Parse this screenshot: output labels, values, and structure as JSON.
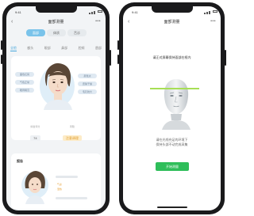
{
  "left_phone": {
    "status_time": "9:41",
    "nav": {
      "back": "‹",
      "title": "面部测量",
      "more": "•••"
    },
    "segments": [
      "面部",
      "体质",
      "舌诊"
    ],
    "feature_tabs": [
      "全脸",
      "额头",
      "眼部",
      "鼻部",
      "脸颊",
      "唇部"
    ],
    "face_chips_left": [
      "面色红润",
      "气色正常",
      "眼周暗沉"
    ],
    "face_chips_right": [
      "唇色淡",
      "皮肤干燥",
      "毛孔较大"
    ],
    "metrics": [
      {
        "label": "综合评分",
        "value": "74"
      },
      {
        "label": "风险",
        "value": "注意调理"
      }
    ],
    "report": {
      "title": "报告",
      "tags": [
        "· 气虚",
        "· 湿热"
      ]
    }
  },
  "right_phone": {
    "status_time": "9:41",
    "nav": {
      "back": "‹",
      "title": "面部测量",
      "more": "•••"
    },
    "hint": "请正对屏幕保持面部在框内",
    "description_lines": [
      "请在光线充足的环境下",
      "保持头部不动完成采集"
    ],
    "start_button": "开始测量"
  },
  "colors": {
    "accent_blue": "#4aa8dc",
    "scan_green": "#a7df55",
    "button_green": "#2fbe5a",
    "warn_orange": "#e09c2b"
  }
}
